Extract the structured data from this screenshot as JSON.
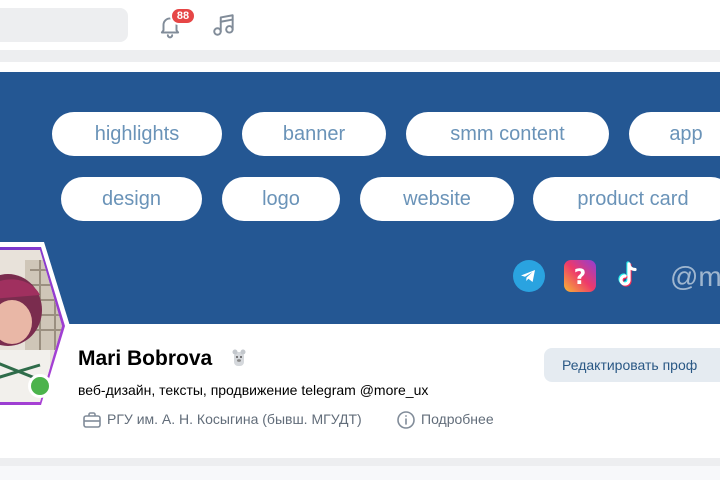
{
  "topbar": {
    "notifications_count": "88",
    "icons": [
      "bell-icon",
      "music-icon"
    ]
  },
  "cover": {
    "tags": [
      "highlights",
      "banner",
      "smm content",
      "app",
      "design",
      "logo",
      "website",
      "product card"
    ],
    "social_icons": [
      "telegram-icon",
      "question-app-icon",
      "tiktok-icon"
    ],
    "handle": "@m"
  },
  "profile": {
    "name": "Mari Bobrova",
    "status": "веб-дизайн, тексты, продвижение telegram @more_ux",
    "education": "РГУ им. А. Н. Косыгина (бывш. МГУДТ)",
    "more": "Подробнее",
    "edit_button": "Редактировать проф",
    "online": true
  },
  "colors": {
    "cover_bg": "#245793",
    "chip_text": "#6a93b8",
    "badge": "#e64646",
    "online": "#4bb34b",
    "button_bg": "#e5ebf1",
    "button_text": "#2a5885"
  }
}
